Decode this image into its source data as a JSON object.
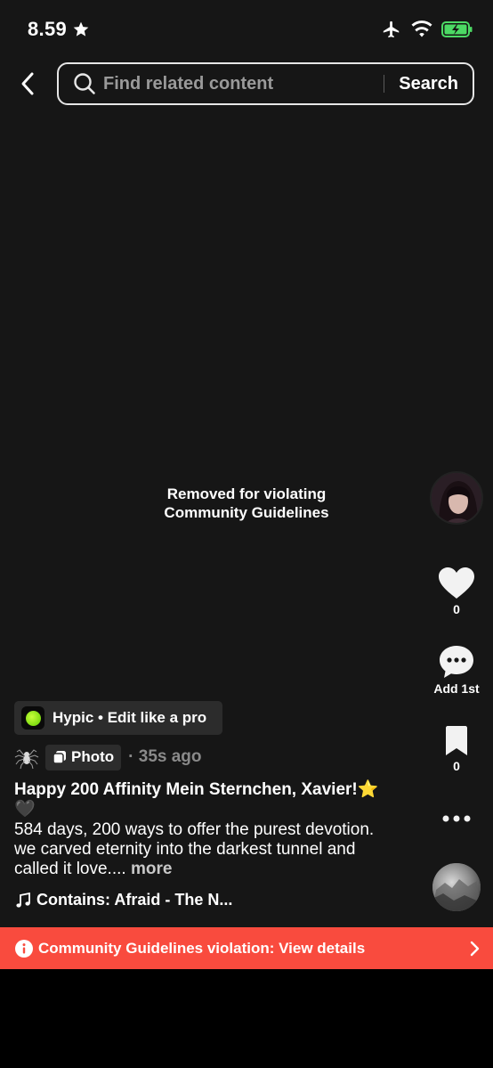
{
  "status_bar": {
    "time": "8.59",
    "star_icon": "star-icon",
    "battery_color": "#4cd964"
  },
  "search": {
    "placeholder": "Find related content",
    "button_label": "Search"
  },
  "content": {
    "removed_message": "Removed for violating Community Guidelines"
  },
  "rail": {
    "like_count": "0",
    "comment_label": "Add 1st",
    "bookmark_count": "0"
  },
  "sponsor": {
    "label": "Hypic • Edit like a pro"
  },
  "post": {
    "type_label": "Photo",
    "time": "· 35s ago",
    "title": "Happy 200 Affinity Mein Sternchen, Xavier!⭐🖤",
    "body": "584 days, 200 ways to offer the purest devotion. we carved eternity into the darkest tunnel and called it love....",
    "more_label": "more",
    "music": "Contains: Afraid - The N..."
  },
  "violation": {
    "text": "Community Guidelines violation: View details",
    "color": "#f94b3e"
  }
}
